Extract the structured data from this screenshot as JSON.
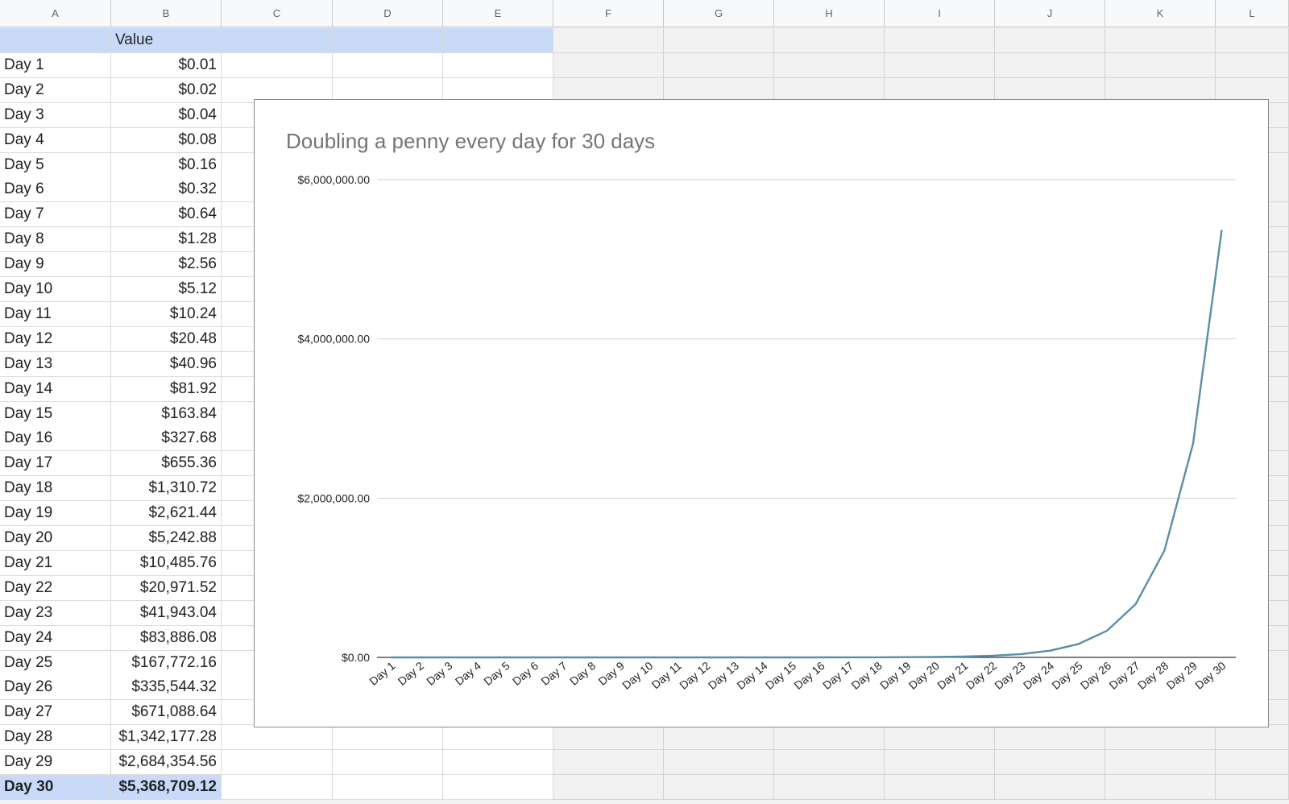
{
  "sheet": {
    "columns": [
      "A",
      "B",
      "C",
      "D",
      "E",
      "F",
      "G",
      "H",
      "I",
      "J",
      "K",
      "L"
    ],
    "header_row": {
      "a": "",
      "b": "Value"
    },
    "rows": [
      {
        "day": "Day 1",
        "value": "$0.01"
      },
      {
        "day": "Day 2",
        "value": "$0.02"
      },
      {
        "day": "Day 3",
        "value": "$0.04"
      },
      {
        "day": "Day 4",
        "value": "$0.08"
      },
      {
        "day": "Day 5",
        "value": "$0.16"
      },
      {
        "day": "Day 6",
        "value": "$0.32"
      },
      {
        "day": "Day 7",
        "value": "$0.64"
      },
      {
        "day": "Day 8",
        "value": "$1.28"
      },
      {
        "day": "Day 9",
        "value": "$2.56"
      },
      {
        "day": "Day 10",
        "value": "$5.12"
      },
      {
        "day": "Day 11",
        "value": "$10.24"
      },
      {
        "day": "Day 12",
        "value": "$20.48"
      },
      {
        "day": "Day 13",
        "value": "$40.96"
      },
      {
        "day": "Day 14",
        "value": "$81.92"
      },
      {
        "day": "Day 15",
        "value": "$163.84"
      },
      {
        "day": "Day 16",
        "value": "$327.68"
      },
      {
        "day": "Day 17",
        "value": "$655.36"
      },
      {
        "day": "Day 18",
        "value": "$1,310.72"
      },
      {
        "day": "Day 19",
        "value": "$2,621.44"
      },
      {
        "day": "Day 20",
        "value": "$5,242.88"
      },
      {
        "day": "Day 21",
        "value": "$10,485.76"
      },
      {
        "day": "Day 22",
        "value": "$20,971.52"
      },
      {
        "day": "Day 23",
        "value": "$41,943.04"
      },
      {
        "day": "Day 24",
        "value": "$83,886.08"
      },
      {
        "day": "Day 25",
        "value": "$167,772.16"
      },
      {
        "day": "Day 26",
        "value": "$335,544.32"
      },
      {
        "day": "Day 27",
        "value": "$671,088.64"
      },
      {
        "day": "Day 28",
        "value": "$1,342,177.28"
      },
      {
        "day": "Day 29",
        "value": "$2,684,354.56"
      },
      {
        "day": "Day 30",
        "value": "$5,368,709.12"
      }
    ],
    "selected_row": 30,
    "selection_color": "#c9daf8"
  },
  "chart_data": {
    "type": "line",
    "title": "Doubling a penny every day for 30 days",
    "xlabel": "",
    "ylabel": "",
    "categories": [
      "Day 1",
      "Day 2",
      "Day 3",
      "Day 4",
      "Day 5",
      "Day 6",
      "Day 7",
      "Day 8",
      "Day 9",
      "Day 10",
      "Day 11",
      "Day 12",
      "Day 13",
      "Day 14",
      "Day 15",
      "Day 16",
      "Day 17",
      "Day 18",
      "Day 19",
      "Day 20",
      "Day 21",
      "Day 22",
      "Day 23",
      "Day 24",
      "Day 25",
      "Day 26",
      "Day 27",
      "Day 28",
      "Day 29",
      "Day 30"
    ],
    "series": [
      {
        "color": "#5b8ea6",
        "values": [
          0.01,
          0.02,
          0.04,
          0.08,
          0.16,
          0.32,
          0.64,
          1.28,
          2.56,
          5.12,
          10.24,
          20.48,
          40.96,
          81.92,
          163.84,
          327.68,
          655.36,
          1310.72,
          2621.44,
          5242.88,
          10485.76,
          20971.52,
          41943.04,
          83886.08,
          167772.16,
          335544.32,
          671088.64,
          1342177.28,
          2684354.56,
          5368709.12
        ]
      }
    ],
    "ylim": [
      0,
      6000000
    ],
    "yticks": [
      {
        "value": 0,
        "label": "$0.00"
      },
      {
        "value": 2000000,
        "label": "$2,000,000.00"
      },
      {
        "value": 4000000,
        "label": "$4,000,000.00"
      },
      {
        "value": 6000000,
        "label": "$6,000,000.00"
      }
    ],
    "grid": true,
    "legend": "none"
  }
}
